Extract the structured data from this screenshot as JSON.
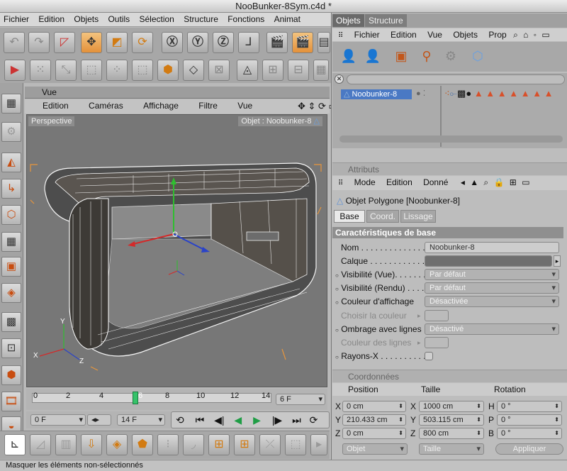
{
  "window": {
    "title": "NooBunker-8Sym.c4d *"
  },
  "menubar": [
    "Fichier",
    "Edition",
    "Objets",
    "Outils",
    "Sélection",
    "Structure",
    "Fonctions",
    "Animat"
  ],
  "toolbar_icons": [
    "undo-icon",
    "redo-icon",
    "live-select-icon",
    "move-icon",
    "scale-icon",
    "rotate-icon",
    "x-axis-icon",
    "y-axis-icon",
    "z-axis-icon",
    "world-coord-icon",
    "render-view-icon",
    "render-picture-icon",
    "render-settings-icon"
  ],
  "viewport_panel": {
    "header": "Vue",
    "menu": [
      "Edition",
      "Caméras",
      "Affichage",
      "Filtre",
      "Vue"
    ],
    "perspective_label": "Perspective",
    "object_label": "Objet : Noobunker-8",
    "axes": {
      "x": "X",
      "y": "Y",
      "z": "Z"
    }
  },
  "timeline": {
    "ticks": [
      "0",
      "2",
      "4",
      "6",
      "8",
      "10",
      "12",
      "14"
    ],
    "current_frame": "6",
    "end_field": "6 F"
  },
  "controls": {
    "start_field": "0 F",
    "end_field": "14 F"
  },
  "status": {
    "text": "Masquer les éléments non-sélectionnés"
  },
  "objects_panel": {
    "tabs": [
      "Objets",
      "Structure"
    ],
    "menu": [
      "Fichier",
      "Edition",
      "Vue",
      "Objets",
      "Prop"
    ],
    "object_name": "Noobunker-8"
  },
  "attributes": {
    "header": "Attributs",
    "menu": [
      "Mode",
      "Edition",
      "Donné"
    ],
    "object_title": "Objet Polygone [Noobunker-8]",
    "tabs": [
      "Base",
      "Coord.",
      "Lissage"
    ],
    "section": "Caractéristiques de base",
    "rows": [
      {
        "label": "Nom . . . . . . . . . . . . . .",
        "value": "Noobunker-8"
      },
      {
        "label": "Calque . . . . . . . . . . . .",
        "value": ""
      },
      {
        "label": "Visibilité (Vue). . . . . . .",
        "value": "Par défaut"
      },
      {
        "label": "Visibilité (Rendu)  . . . .",
        "value": "Par défaut"
      },
      {
        "label": "Couleur d'affichage",
        "value": "Désactivée"
      },
      {
        "label": "Choisir la couleur",
        "value": ""
      },
      {
        "label": "Ombrage avec lignes",
        "value": "Désactivé"
      },
      {
        "label": "Couleur des lignes",
        "value": ""
      },
      {
        "label": "Rayons-X . . . . . . . . . .",
        "value": ""
      }
    ]
  },
  "coordinates": {
    "header": "Coordonnées",
    "col_position": "Position",
    "col_size": "Taille",
    "col_rotation": "Rotation",
    "rows": [
      {
        "pl": "X",
        "pv": "0 cm",
        "sl": "X",
        "sv": "1000 cm",
        "rl": "H",
        "rv": "0 °"
      },
      {
        "pl": "Y",
        "pv": "210.433 cm",
        "sl": "Y",
        "sv": "503.115 cm",
        "rl": "P",
        "rv": "0 °"
      },
      {
        "pl": "Z",
        "pv": "0 cm",
        "sl": "Z",
        "sv": "800 cm",
        "rl": "B",
        "rv": "0 °"
      }
    ],
    "mode_object": "Objet",
    "mode_size": "Taille",
    "apply": "Appliquer"
  },
  "colors": {
    "accent": "#e7953c",
    "selection_blue": "#4a79c4",
    "panel": "#bdbdbd",
    "viewport": "#777777"
  }
}
